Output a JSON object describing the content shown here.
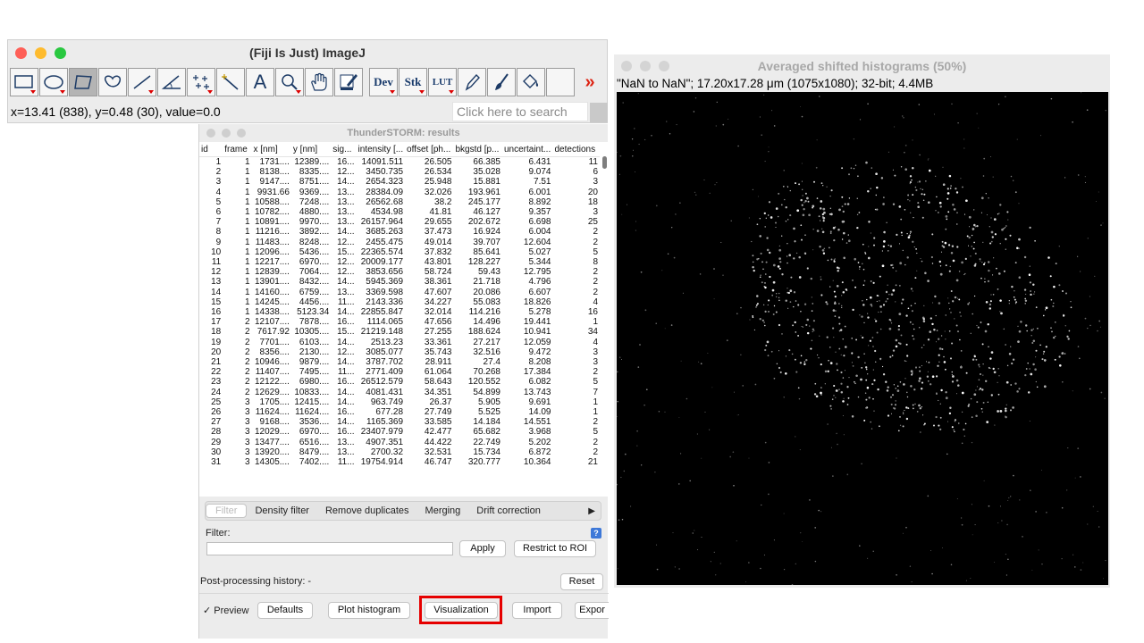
{
  "imagej": {
    "title": "(Fiji Is Just) ImageJ",
    "tools": [
      {
        "name": "rectangle-tool-icon"
      },
      {
        "name": "oval-tool-icon"
      },
      {
        "name": "polygon-tool-icon",
        "active": true
      },
      {
        "name": "freehand-tool-icon"
      },
      {
        "name": "line-tool-icon"
      },
      {
        "name": "angle-tool-icon"
      },
      {
        "name": "multipoint-tool-icon"
      },
      {
        "name": "wand-tool-icon"
      },
      {
        "name": "text-tool-icon"
      },
      {
        "name": "magnifier-tool-icon"
      },
      {
        "name": "hand-tool-icon"
      },
      {
        "name": "color-picker-tool-icon"
      }
    ],
    "tool_dev": "Dev",
    "tool_stk": "Stk",
    "tool_lut": "LUT",
    "more_icon": "»",
    "text_tool_glyph": "A",
    "status": "x=13.41 (838), y=0.48 (30), value=0.0",
    "search_placeholder": "Click here to search"
  },
  "results": {
    "title": "ThunderSTORM: results",
    "columns": [
      "id",
      "frame",
      "x [nm]",
      "y [nm]",
      "sig...",
      "intensity [...",
      "offset [ph...",
      "bkgstd [p...",
      "uncertaint...",
      "detections"
    ],
    "rows": [
      [
        "1",
        "1",
        "1731....",
        "12389....",
        "16...",
        "14091.511",
        "26.505",
        "66.385",
        "6.431",
        "11"
      ],
      [
        "2",
        "1",
        "8138....",
        "8335....",
        "12...",
        "3450.735",
        "26.534",
        "35.028",
        "9.074",
        "6"
      ],
      [
        "3",
        "1",
        "9147....",
        "8751....",
        "14...",
        "2654.323",
        "25.948",
        "15.881",
        "7.51",
        "3"
      ],
      [
        "4",
        "1",
        "9931.66",
        "9369....",
        "13...",
        "28384.09",
        "32.026",
        "193.961",
        "6.001",
        "20"
      ],
      [
        "5",
        "1",
        "10588....",
        "7248....",
        "13...",
        "26562.68",
        "38.2",
        "245.177",
        "8.892",
        "18"
      ],
      [
        "6",
        "1",
        "10782....",
        "4880....",
        "13...",
        "4534.98",
        "41.81",
        "46.127",
        "9.357",
        "3"
      ],
      [
        "7",
        "1",
        "10891....",
        "9970....",
        "13...",
        "26157.964",
        "29.655",
        "202.672",
        "6.698",
        "25"
      ],
      [
        "8",
        "1",
        "11216....",
        "3892....",
        "14...",
        "3685.263",
        "37.473",
        "16.924",
        "6.004",
        "2"
      ],
      [
        "9",
        "1",
        "11483....",
        "8248....",
        "12...",
        "2455.475",
        "49.014",
        "39.707",
        "12.604",
        "2"
      ],
      [
        "10",
        "1",
        "12096....",
        "5436....",
        "15...",
        "22365.574",
        "37.832",
        "85.641",
        "5.027",
        "5"
      ],
      [
        "11",
        "1",
        "12217....",
        "6970....",
        "12...",
        "20009.177",
        "43.801",
        "128.227",
        "5.344",
        "8"
      ],
      [
        "12",
        "1",
        "12839....",
        "7064....",
        "12...",
        "3853.656",
        "58.724",
        "59.43",
        "12.795",
        "2"
      ],
      [
        "13",
        "1",
        "13901....",
        "8432....",
        "14...",
        "5945.369",
        "38.361",
        "21.718",
        "4.796",
        "2"
      ],
      [
        "14",
        "1",
        "14160....",
        "6759....",
        "13...",
        "3369.598",
        "47.607",
        "20.086",
        "6.607",
        "2"
      ],
      [
        "15",
        "1",
        "14245....",
        "4456....",
        "11...",
        "2143.336",
        "34.227",
        "55.083",
        "18.826",
        "4"
      ],
      [
        "16",
        "1",
        "14338....",
        "5123.34",
        "14...",
        "22855.847",
        "32.014",
        "114.216",
        "5.278",
        "16"
      ],
      [
        "17",
        "2",
        "12107....",
        "7878....",
        "16...",
        "1114.065",
        "47.656",
        "14.496",
        "19.441",
        "1"
      ],
      [
        "18",
        "2",
        "7617.92",
        "10305....",
        "15...",
        "21219.148",
        "27.255",
        "188.624",
        "10.941",
        "34"
      ],
      [
        "19",
        "2",
        "7701....",
        "6103....",
        "14...",
        "2513.23",
        "33.361",
        "27.217",
        "12.059",
        "4"
      ],
      [
        "20",
        "2",
        "8356....",
        "2130....",
        "12...",
        "3085.077",
        "35.743",
        "32.516",
        "9.472",
        "3"
      ],
      [
        "21",
        "2",
        "10946....",
        "9879....",
        "14...",
        "3787.702",
        "28.911",
        "27.4",
        "8.208",
        "3"
      ],
      [
        "22",
        "2",
        "11407....",
        "7495....",
        "11...",
        "2771.409",
        "61.064",
        "70.268",
        "17.384",
        "2"
      ],
      [
        "23",
        "2",
        "12122....",
        "6980....",
        "16...",
        "26512.579",
        "58.643",
        "120.552",
        "6.082",
        "5"
      ],
      [
        "24",
        "2",
        "12629....",
        "10833....",
        "14...",
        "4081.431",
        "34.351",
        "54.899",
        "13.743",
        "7"
      ],
      [
        "25",
        "3",
        "1705....",
        "12415....",
        "14...",
        "963.749",
        "26.37",
        "5.905",
        "9.691",
        "1"
      ],
      [
        "26",
        "3",
        "11624....",
        "11624....",
        "16...",
        "677.28",
        "27.749",
        "5.525",
        "14.09",
        "1"
      ],
      [
        "27",
        "3",
        "9168....",
        "3536....",
        "14...",
        "1165.369",
        "33.585",
        "14.184",
        "14.551",
        "2"
      ],
      [
        "28",
        "3",
        "12029....",
        "6970....",
        "16...",
        "23407.979",
        "42.477",
        "65.682",
        "3.968",
        "5"
      ],
      [
        "29",
        "3",
        "13477....",
        "6516....",
        "13...",
        "4907.351",
        "44.422",
        "22.749",
        "5.202",
        "2"
      ],
      [
        "30",
        "3",
        "13920....",
        "8479....",
        "13...",
        "2700.32",
        "32.531",
        "15.734",
        "6.872",
        "2"
      ],
      [
        "31",
        "3",
        "14305....",
        "7402....",
        "11...",
        "19754.914",
        "46.747",
        "320.777",
        "10.364",
        "21"
      ]
    ],
    "tabs": [
      "Filter",
      "Density filter",
      "Remove duplicates",
      "Merging",
      "Drift correction"
    ],
    "tab_more": "▶",
    "filter_label": "Filter:",
    "help_icon": "?",
    "apply_label": "Apply",
    "restrict_label": "Restrict to ROI",
    "history_text": "Post-processing history: -",
    "reset_label": "Reset",
    "preview_label": "✓ Preview",
    "defaults_label": "Defaults",
    "plot_hist_label": "Plot histogram",
    "visualization_label": "Visualization",
    "import_label": "Import",
    "export_label": "Expor"
  },
  "histogram": {
    "title": "Averaged shifted histograms (50%)",
    "info": "\"NaN to NaN\"; 17.20x17.28 μm (1075x1080); 32-bit; 4.4MB"
  },
  "colors": {
    "highlight": "#e60000",
    "accent_blue": "#3d78d8",
    "tool_arrow": "#d00000"
  }
}
